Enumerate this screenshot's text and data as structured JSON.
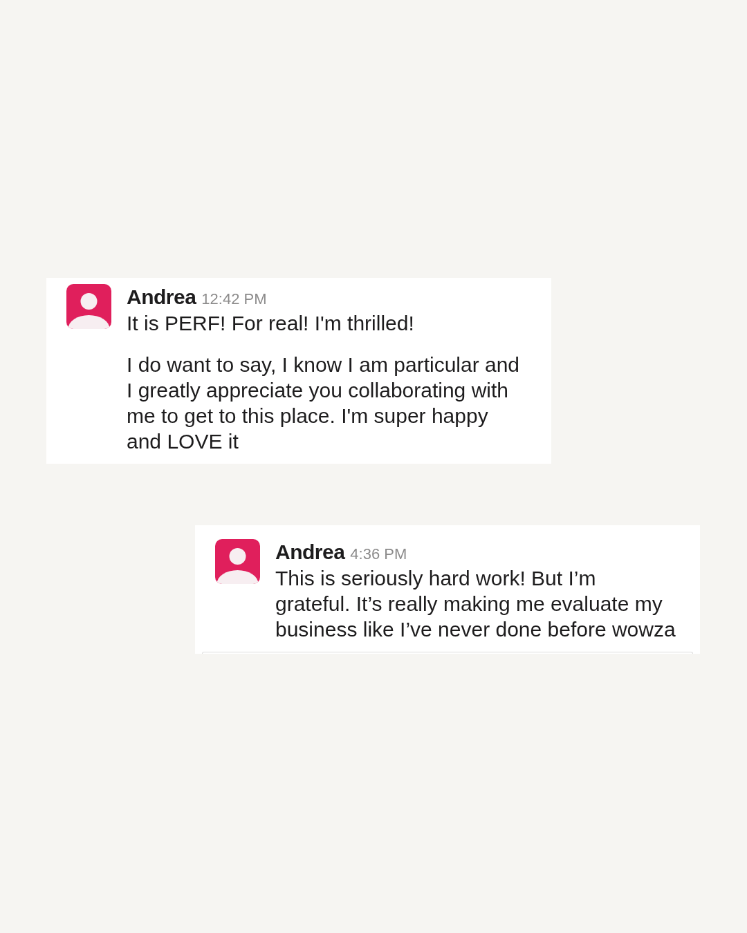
{
  "messages": [
    {
      "author": "Andrea",
      "time": "12:42 PM",
      "paragraphs": [
        "It is PERF! For real! I'm thrilled!",
        "I do want to say, I know I am particular and I greatly appreciate you collaborating with me to get to this place. I'm super happy and LOVE it"
      ]
    },
    {
      "author": "Andrea",
      "time": "4:36 PM",
      "paragraphs": [
        "This is seriously hard work! But I’m grateful. It’s really making me evaluate my business like I’ve never done before wowza"
      ]
    }
  ]
}
